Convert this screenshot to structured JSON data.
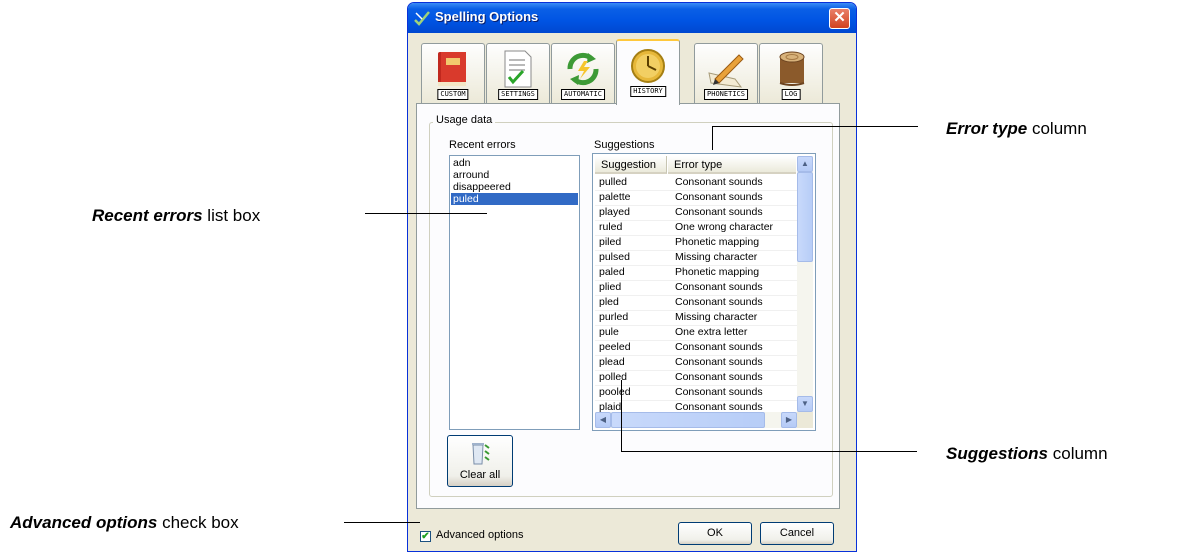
{
  "window": {
    "title": "Spelling Options",
    "close_glyph": "✕"
  },
  "tabs": [
    {
      "label": "CUSTOM",
      "icon": "red-book-icon"
    },
    {
      "label": "SETTINGS",
      "icon": "checklist-document-icon"
    },
    {
      "label": "AUTOMATIC",
      "icon": "recycle-arrows-icon"
    },
    {
      "label": "HISTORY",
      "icon": "clock-icon",
      "active": true
    },
    {
      "label": "PHONETICS",
      "icon": "pencil-writing-icon"
    },
    {
      "label": "LOG",
      "icon": "tree-log-icon"
    }
  ],
  "usage_group": {
    "legend": "Usage data",
    "recent_label": "Recent errors",
    "suggestions_label": "Suggestions",
    "recent_errors": [
      "adn",
      "arround",
      "disappeered",
      "puled"
    ],
    "selected_recent": "puled",
    "columns": [
      "Suggestion",
      "Error type"
    ],
    "rows": [
      [
        "pulled",
        "Consonant sounds"
      ],
      [
        "palette",
        "Consonant sounds"
      ],
      [
        "played",
        "Consonant sounds"
      ],
      [
        "ruled",
        "One wrong character"
      ],
      [
        "piled",
        "Phonetic mapping"
      ],
      [
        "pulsed",
        "Missing character"
      ],
      [
        "paled",
        "Phonetic mapping"
      ],
      [
        "plied",
        "Consonant sounds"
      ],
      [
        "pled",
        "Consonant sounds"
      ],
      [
        "purled",
        "Missing character"
      ],
      [
        "pule",
        "One extra letter"
      ],
      [
        "peeled",
        "Consonant sounds"
      ],
      [
        "plead",
        "Consonant sounds"
      ],
      [
        "polled",
        "Consonant sounds"
      ],
      [
        "pooled",
        "Consonant sounds"
      ],
      [
        "plaid",
        "Consonant sounds"
      ]
    ],
    "clear_all_label": "Clear all"
  },
  "footer": {
    "advanced_label": "Advanced options",
    "advanced_checked": true,
    "ok_label": "OK",
    "cancel_label": "Cancel"
  },
  "annotations": {
    "error_type_bold": "Error type",
    "error_type_rest": " column",
    "recent_bold": "Recent errors",
    "recent_rest": " list box",
    "suggestions_bold": "Suggestions",
    "suggestions_rest": " column",
    "advanced_bold": "Advanced options",
    "advanced_rest": " check box"
  }
}
